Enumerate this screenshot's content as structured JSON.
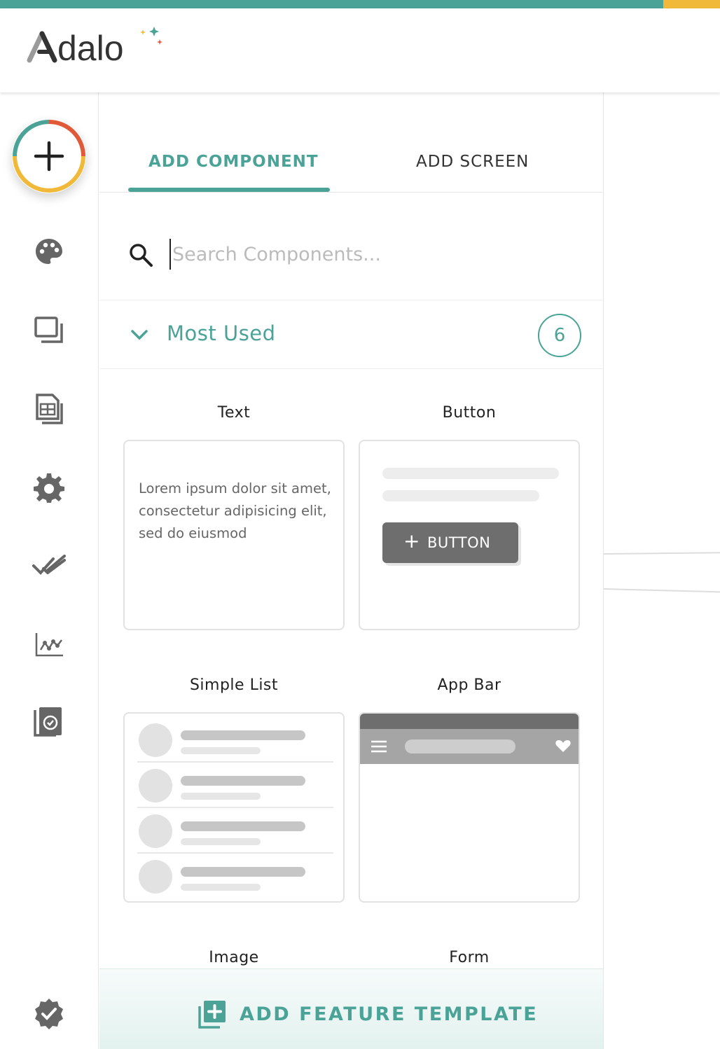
{
  "brand": {
    "name": "Adalo",
    "primary_color": "#4aa396",
    "accent_yellow": "#f0b93a",
    "accent_red": "#e05a3a"
  },
  "sidebar": {
    "add_button_icon": "plus-icon",
    "items": [
      {
        "icon": "palette-icon"
      },
      {
        "icon": "screens-icon"
      },
      {
        "icon": "database-icon"
      },
      {
        "icon": "gear-icon"
      },
      {
        "icon": "double-check-icon"
      },
      {
        "icon": "analytics-icon"
      },
      {
        "icon": "publish-icon"
      }
    ],
    "bottom_icon": "verified-badge-icon"
  },
  "tabs": [
    {
      "label": "ADD COMPONENT",
      "active": true
    },
    {
      "label": "ADD SCREEN",
      "active": false
    }
  ],
  "search": {
    "placeholder": "Search Components...",
    "value": ""
  },
  "section": {
    "title": "Most Used",
    "count": "6",
    "expanded": true
  },
  "components": [
    {
      "label": "Text",
      "preview_text": "Lorem ipsum dolor sit amet, consectetur adipisicing elit, sed do eiusmod"
    },
    {
      "label": "Button",
      "preview_button": "BUTTON"
    },
    {
      "label": "Simple List"
    },
    {
      "label": "App Bar"
    },
    {
      "label": "Image"
    },
    {
      "label": "Form"
    }
  ],
  "footer": {
    "label": "ADD FEATURE TEMPLATE"
  }
}
